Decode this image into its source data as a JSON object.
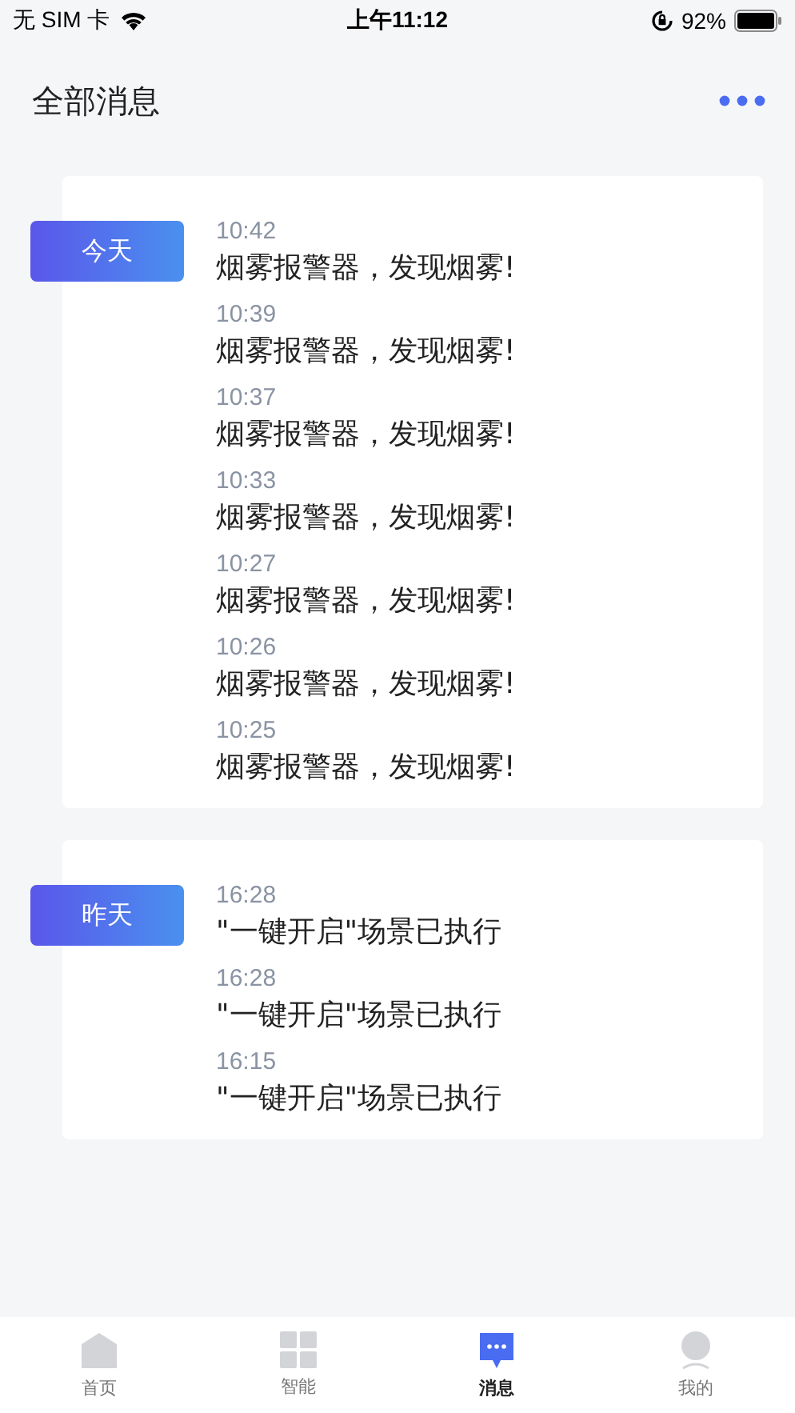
{
  "status_bar": {
    "carrier": "无 SIM 卡",
    "time": "上午11:12",
    "battery": "92%"
  },
  "header": {
    "title": "全部消息"
  },
  "groups": [
    {
      "label": "今天",
      "items": [
        {
          "time": "10:42",
          "text": "烟雾报警器，发现烟雾!"
        },
        {
          "time": "10:39",
          "text": "烟雾报警器，发现烟雾!"
        },
        {
          "time": "10:37",
          "text": "烟雾报警器，发现烟雾!"
        },
        {
          "time": "10:33",
          "text": "烟雾报警器，发现烟雾!"
        },
        {
          "time": "10:27",
          "text": "烟雾报警器，发现烟雾!"
        },
        {
          "time": "10:26",
          "text": "烟雾报警器，发现烟雾!"
        },
        {
          "time": "10:25",
          "text": "烟雾报警器，发现烟雾!"
        }
      ]
    },
    {
      "label": "昨天",
      "items": [
        {
          "time": "16:28",
          "text": "\"一键开启\"场景已执行"
        },
        {
          "time": "16:28",
          "text": "\"一键开启\"场景已执行"
        },
        {
          "time": "16:15",
          "text": "\"一键开启\"场景已执行"
        }
      ]
    }
  ],
  "tab_bar": [
    {
      "label": "首页",
      "kind": "home",
      "selected": false
    },
    {
      "label": "智能",
      "kind": "grid",
      "selected": false
    },
    {
      "label": "消息",
      "kind": "message",
      "selected": true
    },
    {
      "label": "我的",
      "kind": "profile",
      "selected": false
    }
  ]
}
